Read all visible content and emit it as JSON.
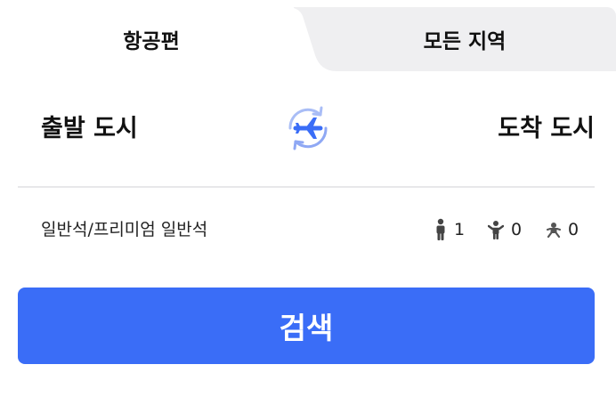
{
  "tabs": {
    "flight_label": "항공편",
    "all_regions_label": "모든 지역"
  },
  "route": {
    "departure_placeholder": "출발 도시",
    "arrival_placeholder": "도착 도시",
    "swap_icon": "plane-swap-icon"
  },
  "cabin": {
    "label": "일반석/프리미엄 일반석"
  },
  "passengers": {
    "adult_count": "1",
    "child_count": "0",
    "infant_count": "0",
    "adult_icon": "adult-icon",
    "child_icon": "child-icon",
    "infant_icon": "infant-icon"
  },
  "search": {
    "label": "검색"
  },
  "colors": {
    "accent": "#3a6df7",
    "inactive_tab": "#efeff1",
    "text": "#111111"
  }
}
